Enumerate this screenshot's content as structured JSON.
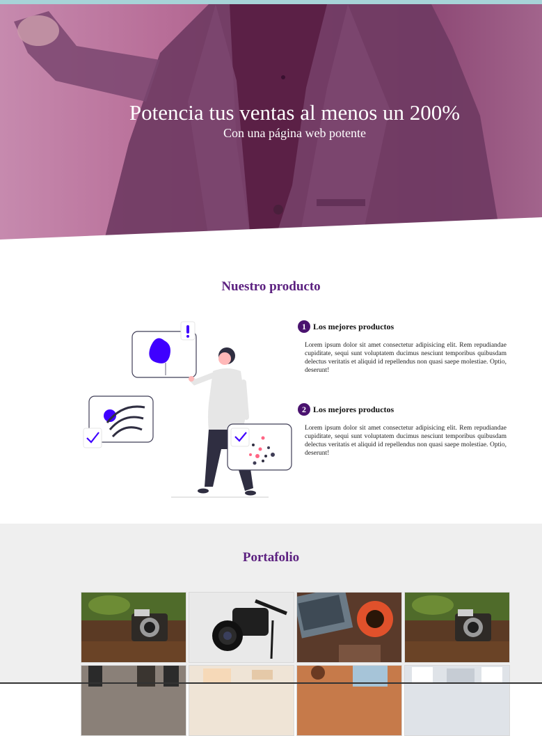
{
  "hero": {
    "title": "Potencia tus ventas al menos un 200%",
    "subtitle": "Con una página web potente"
  },
  "producto": {
    "title": "Nuestro producto",
    "features": [
      {
        "number": "1",
        "title": "Los mejores productos",
        "text": "Lorem ipsum dolor sit amet consectetur adipisicing elit. Rem repudiandae cupiditate, sequi sunt voluptatem ducimus nesciunt temporibus quibusdam delectus veritatis et aliquid id repellendus non quasi saepe molestiae. Optio, deserunt!"
      },
      {
        "number": "2",
        "title": "Los mejores productos",
        "text": "Lorem ipsum dolor sit amet consectetur adipisicing elit. Rem repudiandae cupiditate, sequi sunt voluptatem ducimus nesciunt temporibus quibusdam delectus veritatis et aliquid id repellendus non quasi saepe molestiae. Optio, deserunt!"
      }
    ]
  },
  "portafolio": {
    "title": "Portafolio"
  },
  "colors": {
    "accent": "#5c2180",
    "badge": "#4a136f",
    "hero_overlay": "#a35a86",
    "illustration_blue": "#3f00ff"
  }
}
